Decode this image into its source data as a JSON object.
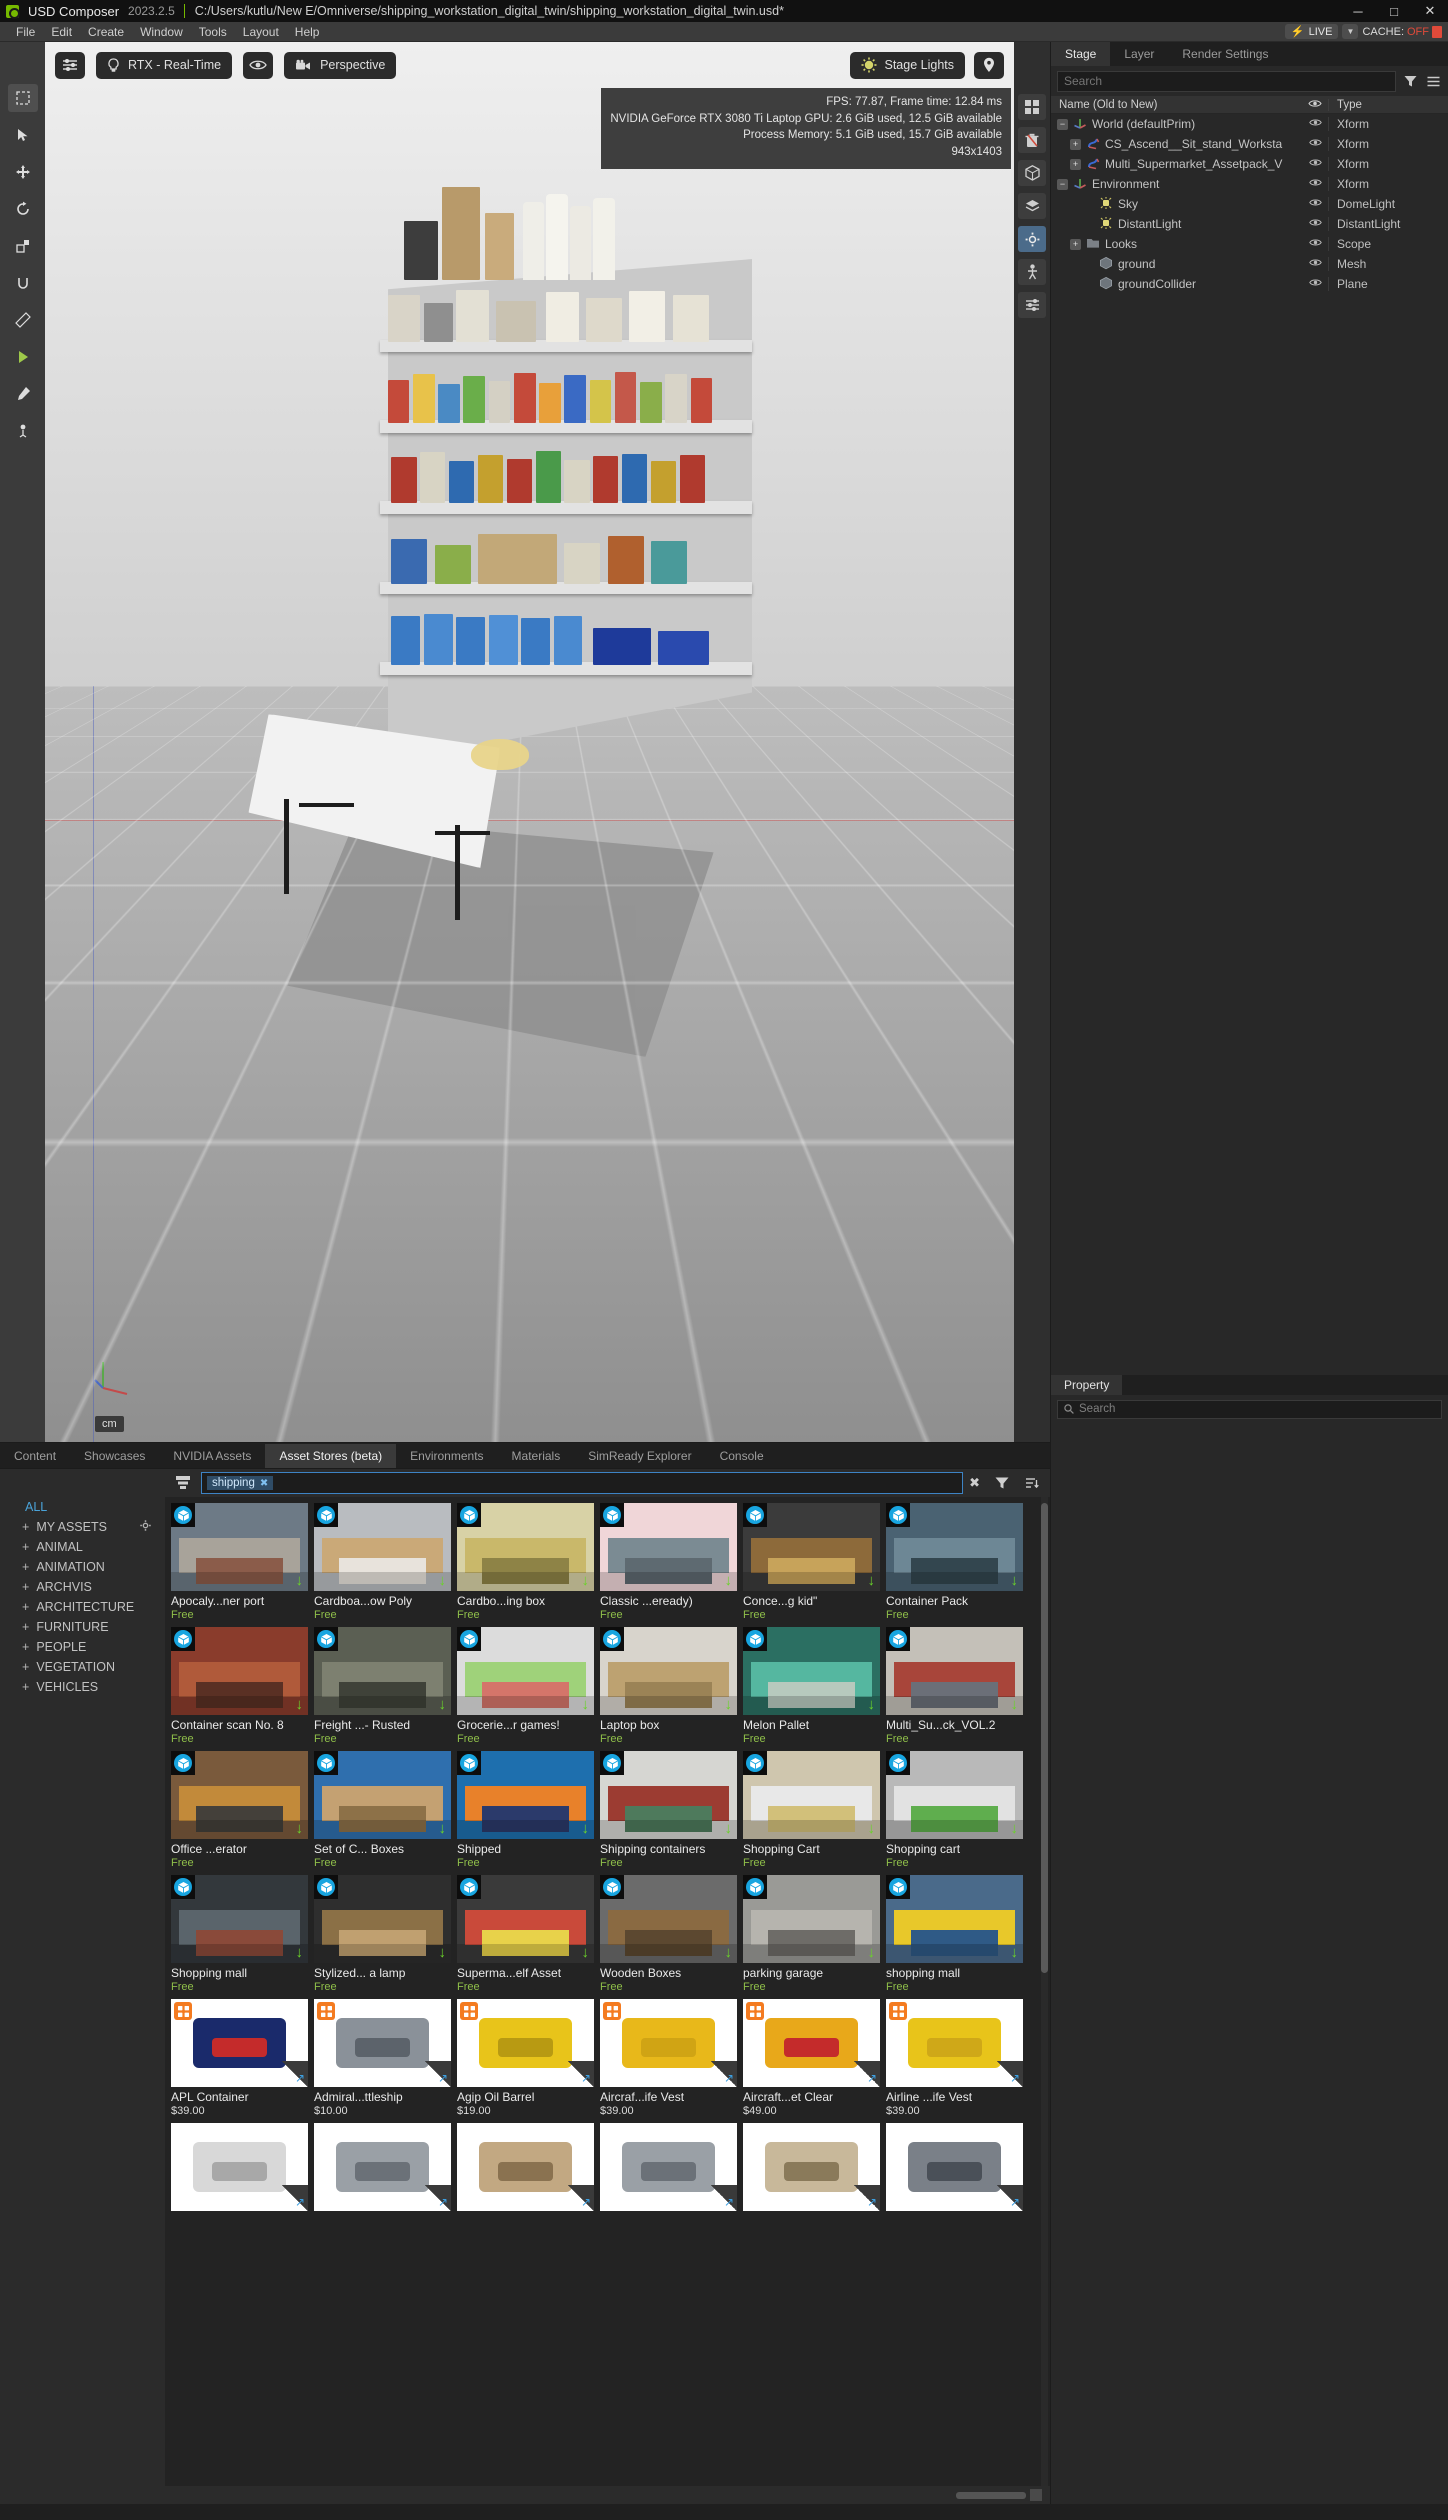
{
  "titlebar": {
    "app_name": "USD Composer",
    "version": "2023.2.5",
    "path": "C:/Users/kutlu/New E/Omniverse/shipping_workstation_digital_twin/shipping_workstation_digital_twin.usd*",
    "minimize": "─",
    "maximize": "□",
    "close": "✕"
  },
  "menubar": {
    "items": [
      "File",
      "Edit",
      "Create",
      "Window",
      "Tools",
      "Layout",
      "Help"
    ],
    "live_label": "LIVE",
    "cache_label": "CACHE:",
    "cache_value": "OFF"
  },
  "viewport": {
    "settings_button": "viewport-settings",
    "renderer": "RTX - Real-Time",
    "camera": "Perspective",
    "lighting": "Stage Lights",
    "stats": {
      "fps_line": "FPS: 77.87, Frame time: 12.84 ms",
      "gpu_line": "NVIDIA GeForce RTX 3080 Ti Laptop GPU: 2.6 GiB used, 12.5 GiB available",
      "memory_line": "Process Memory: 5.1 GiB used, 15.7 GiB available",
      "resolution": "943x1403"
    },
    "unit": "cm"
  },
  "stage_panel": {
    "tabs": [
      {
        "label": "Stage",
        "active": true
      },
      {
        "label": "Layer",
        "active": false
      },
      {
        "label": "Render Settings",
        "active": false
      }
    ],
    "search_placeholder": "Search",
    "columns": {
      "name": "Name (Old to New)",
      "type": "Type"
    },
    "rows": [
      {
        "label": "World (defaultPrim)",
        "type": "Xform",
        "indent": 0,
        "toggle": "minus",
        "icon": "xform-axis-icon"
      },
      {
        "label": "CS_Ascend__Sit_stand_Worksta",
        "type": "Xform",
        "indent": 1,
        "toggle": "plus",
        "icon": "reference-xform-icon"
      },
      {
        "label": "Multi_Supermarket_Assetpack_V",
        "type": "Xform",
        "indent": 1,
        "toggle": "plus",
        "icon": "reference-xform-icon"
      },
      {
        "label": "Environment",
        "type": "Xform",
        "indent": 0,
        "toggle": "minus",
        "icon": "xform-axis-icon"
      },
      {
        "label": "Sky",
        "type": "DomeLight",
        "indent": 2,
        "toggle": "none",
        "icon": "light-icon"
      },
      {
        "label": "DistantLight",
        "type": "DistantLight",
        "indent": 2,
        "toggle": "none",
        "icon": "light-icon"
      },
      {
        "label": "Looks",
        "type": "Scope",
        "indent": 1,
        "toggle": "plus",
        "icon": "folder-icon"
      },
      {
        "label": "ground",
        "type": "Mesh",
        "indent": 2,
        "toggle": "none",
        "icon": "mesh-cube-icon"
      },
      {
        "label": "groundCollider",
        "type": "Plane",
        "indent": 2,
        "toggle": "none",
        "icon": "mesh-cube-icon"
      }
    ]
  },
  "property_panel": {
    "tab": "Property",
    "search_placeholder": "Search"
  },
  "bottom_tabs": [
    {
      "label": "Content",
      "active": false
    },
    {
      "label": "Showcases",
      "active": false
    },
    {
      "label": "NVIDIA Assets",
      "active": false
    },
    {
      "label": "Asset Stores (beta)",
      "active": true
    },
    {
      "label": "Environments",
      "active": false
    },
    {
      "label": "Materials",
      "active": false
    },
    {
      "label": "SimReady Explorer",
      "active": false
    },
    {
      "label": "Console",
      "active": false
    }
  ],
  "asset_browser": {
    "search_chip": "shipping",
    "categories": [
      {
        "label": "ALL",
        "prefix": "",
        "all": true,
        "gear": false
      },
      {
        "label": "MY ASSETS",
        "prefix": "+",
        "all": false,
        "gear": true
      },
      {
        "label": "ANIMAL",
        "prefix": "+",
        "all": false,
        "gear": false
      },
      {
        "label": "ANIMATION",
        "prefix": "+",
        "all": false,
        "gear": false
      },
      {
        "label": "ARCHVIS",
        "prefix": "+",
        "all": false,
        "gear": false
      },
      {
        "label": "ARCHITECTURE",
        "prefix": "+",
        "all": false,
        "gear": false
      },
      {
        "label": "FURNITURE",
        "prefix": "+",
        "all": false,
        "gear": false
      },
      {
        "label": "PEOPLE",
        "prefix": "+",
        "all": false,
        "gear": false
      },
      {
        "label": "VEGETATION",
        "prefix": "+",
        "all": false,
        "gear": false
      },
      {
        "label": "VEHICLES",
        "prefix": "+",
        "all": false,
        "gear": false
      }
    ],
    "rows": [
      [
        {
          "title": "Apocaly...ner port",
          "price": "Free",
          "paid": false,
          "badge": "turbosquid",
          "selected": false,
          "c1": "#6d7a86",
          "c2": "#a8a39a",
          "c3": "#8b5c4a"
        },
        {
          "title": "Cardboa...ow Poly",
          "price": "Free",
          "paid": false,
          "badge": "turbosquid",
          "selected": false,
          "c1": "#b9bcc0",
          "c2": "#caa978",
          "c3": "#e8e3dc"
        },
        {
          "title": "Cardbo...ing box",
          "price": "Free",
          "paid": false,
          "badge": "turbosquid",
          "selected": false,
          "c1": "#d8d2a6",
          "c2": "#c9b86a",
          "c3": "#8e8346"
        },
        {
          "title": "Classic ...eready)",
          "price": "Free",
          "paid": false,
          "badge": "turbosquid",
          "selected": false,
          "c1": "#f0d6d8",
          "c2": "#7b8b93",
          "c3": "#5e6a71"
        },
        {
          "title": "Conce...g kid\"",
          "price": "Free",
          "paid": false,
          "badge": "turbosquid",
          "selected": false,
          "c1": "#3b3b3b",
          "c2": "#8d6a3a",
          "c3": "#c7a35a"
        },
        {
          "title": "Container Pack",
          "price": "Free",
          "paid": false,
          "badge": "turbosquid",
          "selected": false,
          "c1": "#4a6272",
          "c2": "#6d8795",
          "c3": "#33464f"
        }
      ],
      [
        {
          "title": "Container scan No. 8",
          "price": "Free",
          "paid": false,
          "badge": "turbosquid",
          "selected": false,
          "c1": "#8a3c2c",
          "c2": "#b05a3a",
          "c3": "#5a3024"
        },
        {
          "title": "Freight ...- Rusted",
          "price": "Free",
          "paid": false,
          "badge": "turbosquid",
          "selected": false,
          "c1": "#5b5f53",
          "c2": "#7d8070",
          "c3": "#3f4239"
        },
        {
          "title": "Grocerie...r games!",
          "price": "Free",
          "paid": false,
          "badge": "turbosquid",
          "selected": false,
          "c1": "#dcdcdc",
          "c2": "#9fd27a",
          "c3": "#d4756a"
        },
        {
          "title": "Laptop box",
          "price": "Free",
          "paid": false,
          "badge": "turbosquid",
          "selected": false,
          "c1": "#d8d4cc",
          "c2": "#bda271",
          "c3": "#9b8356"
        },
        {
          "title": "Melon Pallet",
          "price": "Free",
          "paid": false,
          "badge": "turbosquid",
          "selected": false,
          "c1": "#2b6f62",
          "c2": "#55b7a0",
          "c3": "#b7c9bd"
        },
        {
          "title": "Multi_Su...ck_VOL.2",
          "price": "Free",
          "paid": false,
          "badge": "turbosquid",
          "selected": true,
          "c1": "#c4c0b8",
          "c2": "#a8453a",
          "c3": "#6b6f78"
        }
      ],
      [
        {
          "title": "Office ...erator",
          "price": "Free",
          "paid": false,
          "badge": "turbosquid",
          "selected": false,
          "c1": "#7a5a3c",
          "c2": "#c28a3a",
          "c3": "#44403a"
        },
        {
          "title": "Set of C... Boxes",
          "price": "Free",
          "paid": false,
          "badge": "turbosquid",
          "selected": false,
          "c1": "#2f6fae",
          "c2": "#c4a172",
          "c3": "#8d7148"
        },
        {
          "title": "Shipped",
          "price": "Free",
          "paid": false,
          "badge": "turbosquid",
          "selected": false,
          "c1": "#1e6fae",
          "c2": "#e8812a",
          "c3": "#2b3a6b"
        },
        {
          "title": "Shipping containers",
          "price": "Free",
          "paid": false,
          "badge": "turbosquid",
          "selected": false,
          "c1": "#d6d6d2",
          "c2": "#9c3c32",
          "c3": "#4e7a5c"
        },
        {
          "title": "Shopping Cart",
          "price": "Free",
          "paid": false,
          "badge": "turbosquid",
          "selected": false,
          "c1": "#cfc6ae",
          "c2": "#e8e8e8",
          "c3": "#d2c07a"
        },
        {
          "title": "Shopping cart",
          "price": "Free",
          "paid": false,
          "badge": "turbosquid",
          "selected": false,
          "c1": "#b9b9b9",
          "c2": "#e2e2e2",
          "c3": "#5fae4e"
        }
      ],
      [
        {
          "title": "Shopping mall",
          "price": "Free",
          "paid": false,
          "badge": "turbosquid",
          "selected": false,
          "c1": "#33383c",
          "c2": "#5a646b",
          "c3": "#8a4a3a"
        },
        {
          "title": "Stylized... a lamp",
          "price": "Free",
          "paid": false,
          "badge": "turbosquid",
          "selected": false,
          "c1": "#2e2e2e",
          "c2": "#8b7046",
          "c3": "#c0a070"
        },
        {
          "title": "Superma...elf Asset",
          "price": "Free",
          "paid": false,
          "badge": "turbosquid",
          "selected": false,
          "c1": "#3a3a3a",
          "c2": "#c94a3a",
          "c3": "#e8d24a"
        },
        {
          "title": "Wooden Boxes",
          "price": "Free",
          "paid": false,
          "badge": "turbosquid",
          "selected": false,
          "c1": "#6b6b6b",
          "c2": "#8a6a42",
          "c3": "#5c4830"
        },
        {
          "title": "parking garage",
          "price": "Free",
          "paid": false,
          "badge": "turbosquid",
          "selected": false,
          "c1": "#9a9a96",
          "c2": "#b6b4ae",
          "c3": "#6e6c68"
        },
        {
          "title": "shopping mall",
          "price": "Free",
          "paid": false,
          "badge": "turbosquid",
          "selected": false,
          "c1": "#4a6a8a",
          "c2": "#e8c82a",
          "c3": "#2f5a86"
        }
      ],
      [
        {
          "title": "APL Container",
          "price": "$39.00",
          "paid": true,
          "badge": "sketchfab",
          "selected": false,
          "c1": "#ffffff",
          "c2": "#1a2a6b",
          "c3": "#c42b2b"
        },
        {
          "title": "Admiral...ttleship",
          "price": "$10.00",
          "paid": true,
          "badge": "sketchfab",
          "selected": false,
          "c1": "#ffffff",
          "c2": "#8a9199",
          "c3": "#5c636b"
        },
        {
          "title": "Agip Oil Barrel",
          "price": "$19.00",
          "paid": true,
          "badge": "sketchfab",
          "selected": false,
          "c1": "#ffffff",
          "c2": "#e8c41a",
          "c3": "#b89a12"
        },
        {
          "title": "Aircraf...ife Vest",
          "price": "$39.00",
          "paid": true,
          "badge": "sketchfab",
          "selected": false,
          "c1": "#ffffff",
          "c2": "#e8b81a",
          "c3": "#d0a414"
        },
        {
          "title": "Aircraft...et Clear",
          "price": "$49.00",
          "paid": true,
          "badge": "sketchfab",
          "selected": false,
          "c1": "#ffffff",
          "c2": "#e8a81a",
          "c3": "#c42b2b"
        },
        {
          "title": "Airline ...ife Vest",
          "price": "$39.00",
          "paid": true,
          "badge": "sketchfab",
          "selected": false,
          "c1": "#ffffff",
          "c2": "#e8c41a",
          "c3": "#cfa818"
        }
      ],
      [
        {
          "title": "",
          "price": "",
          "paid": true,
          "badge": "none",
          "selected": false,
          "c1": "#ffffff",
          "c2": "#d8d8d8",
          "c3": "#a8a8a8"
        },
        {
          "title": "",
          "price": "",
          "paid": true,
          "badge": "none",
          "selected": false,
          "c1": "#ffffff",
          "c2": "#9aa0a6",
          "c3": "#6b7178"
        },
        {
          "title": "",
          "price": "",
          "paid": true,
          "badge": "none",
          "selected": false,
          "c1": "#ffffff",
          "c2": "#c2a882",
          "c3": "#8a7250"
        },
        {
          "title": "",
          "price": "",
          "paid": true,
          "badge": "none",
          "selected": false,
          "c1": "#ffffff",
          "c2": "#9aa0a6",
          "c3": "#6b7178"
        },
        {
          "title": "",
          "price": "",
          "paid": true,
          "badge": "none",
          "selected": false,
          "c1": "#ffffff",
          "c2": "#c8b89a",
          "c3": "#8a7a5a"
        },
        {
          "title": "",
          "price": "",
          "paid": true,
          "badge": "none",
          "selected": false,
          "c1": "#ffffff",
          "c2": "#7a8088",
          "c3": "#4a5058"
        }
      ]
    ]
  }
}
